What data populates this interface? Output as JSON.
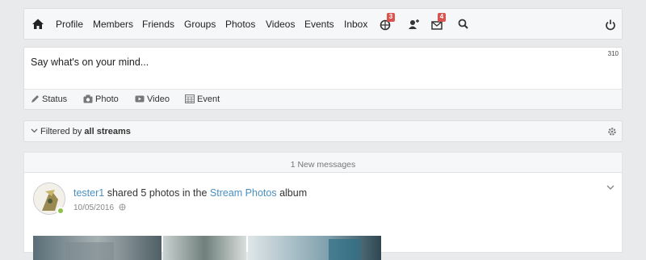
{
  "nav": {
    "items": [
      "Profile",
      "Members",
      "Friends",
      "Groups",
      "Photos",
      "Videos",
      "Events",
      "Inbox"
    ],
    "notifications_badge": "3",
    "messages_badge": "4"
  },
  "composer": {
    "placeholder": "Say what's on your mind...",
    "char_count": "310",
    "actions": [
      "Status",
      "Photo",
      "Video",
      "Event"
    ]
  },
  "filter": {
    "prefix": "Filtered by",
    "value": "all streams"
  },
  "new_messages": "1 New messages",
  "stream_item": {
    "user": "tester1",
    "action_text": "shared 5 photos in the",
    "album_link": "Stream Photos",
    "suffix": "album",
    "date": "10/05/2016"
  },
  "colors": {
    "link": "#4a90c2",
    "badge": "#d9534f",
    "online": "#8bc34a"
  }
}
